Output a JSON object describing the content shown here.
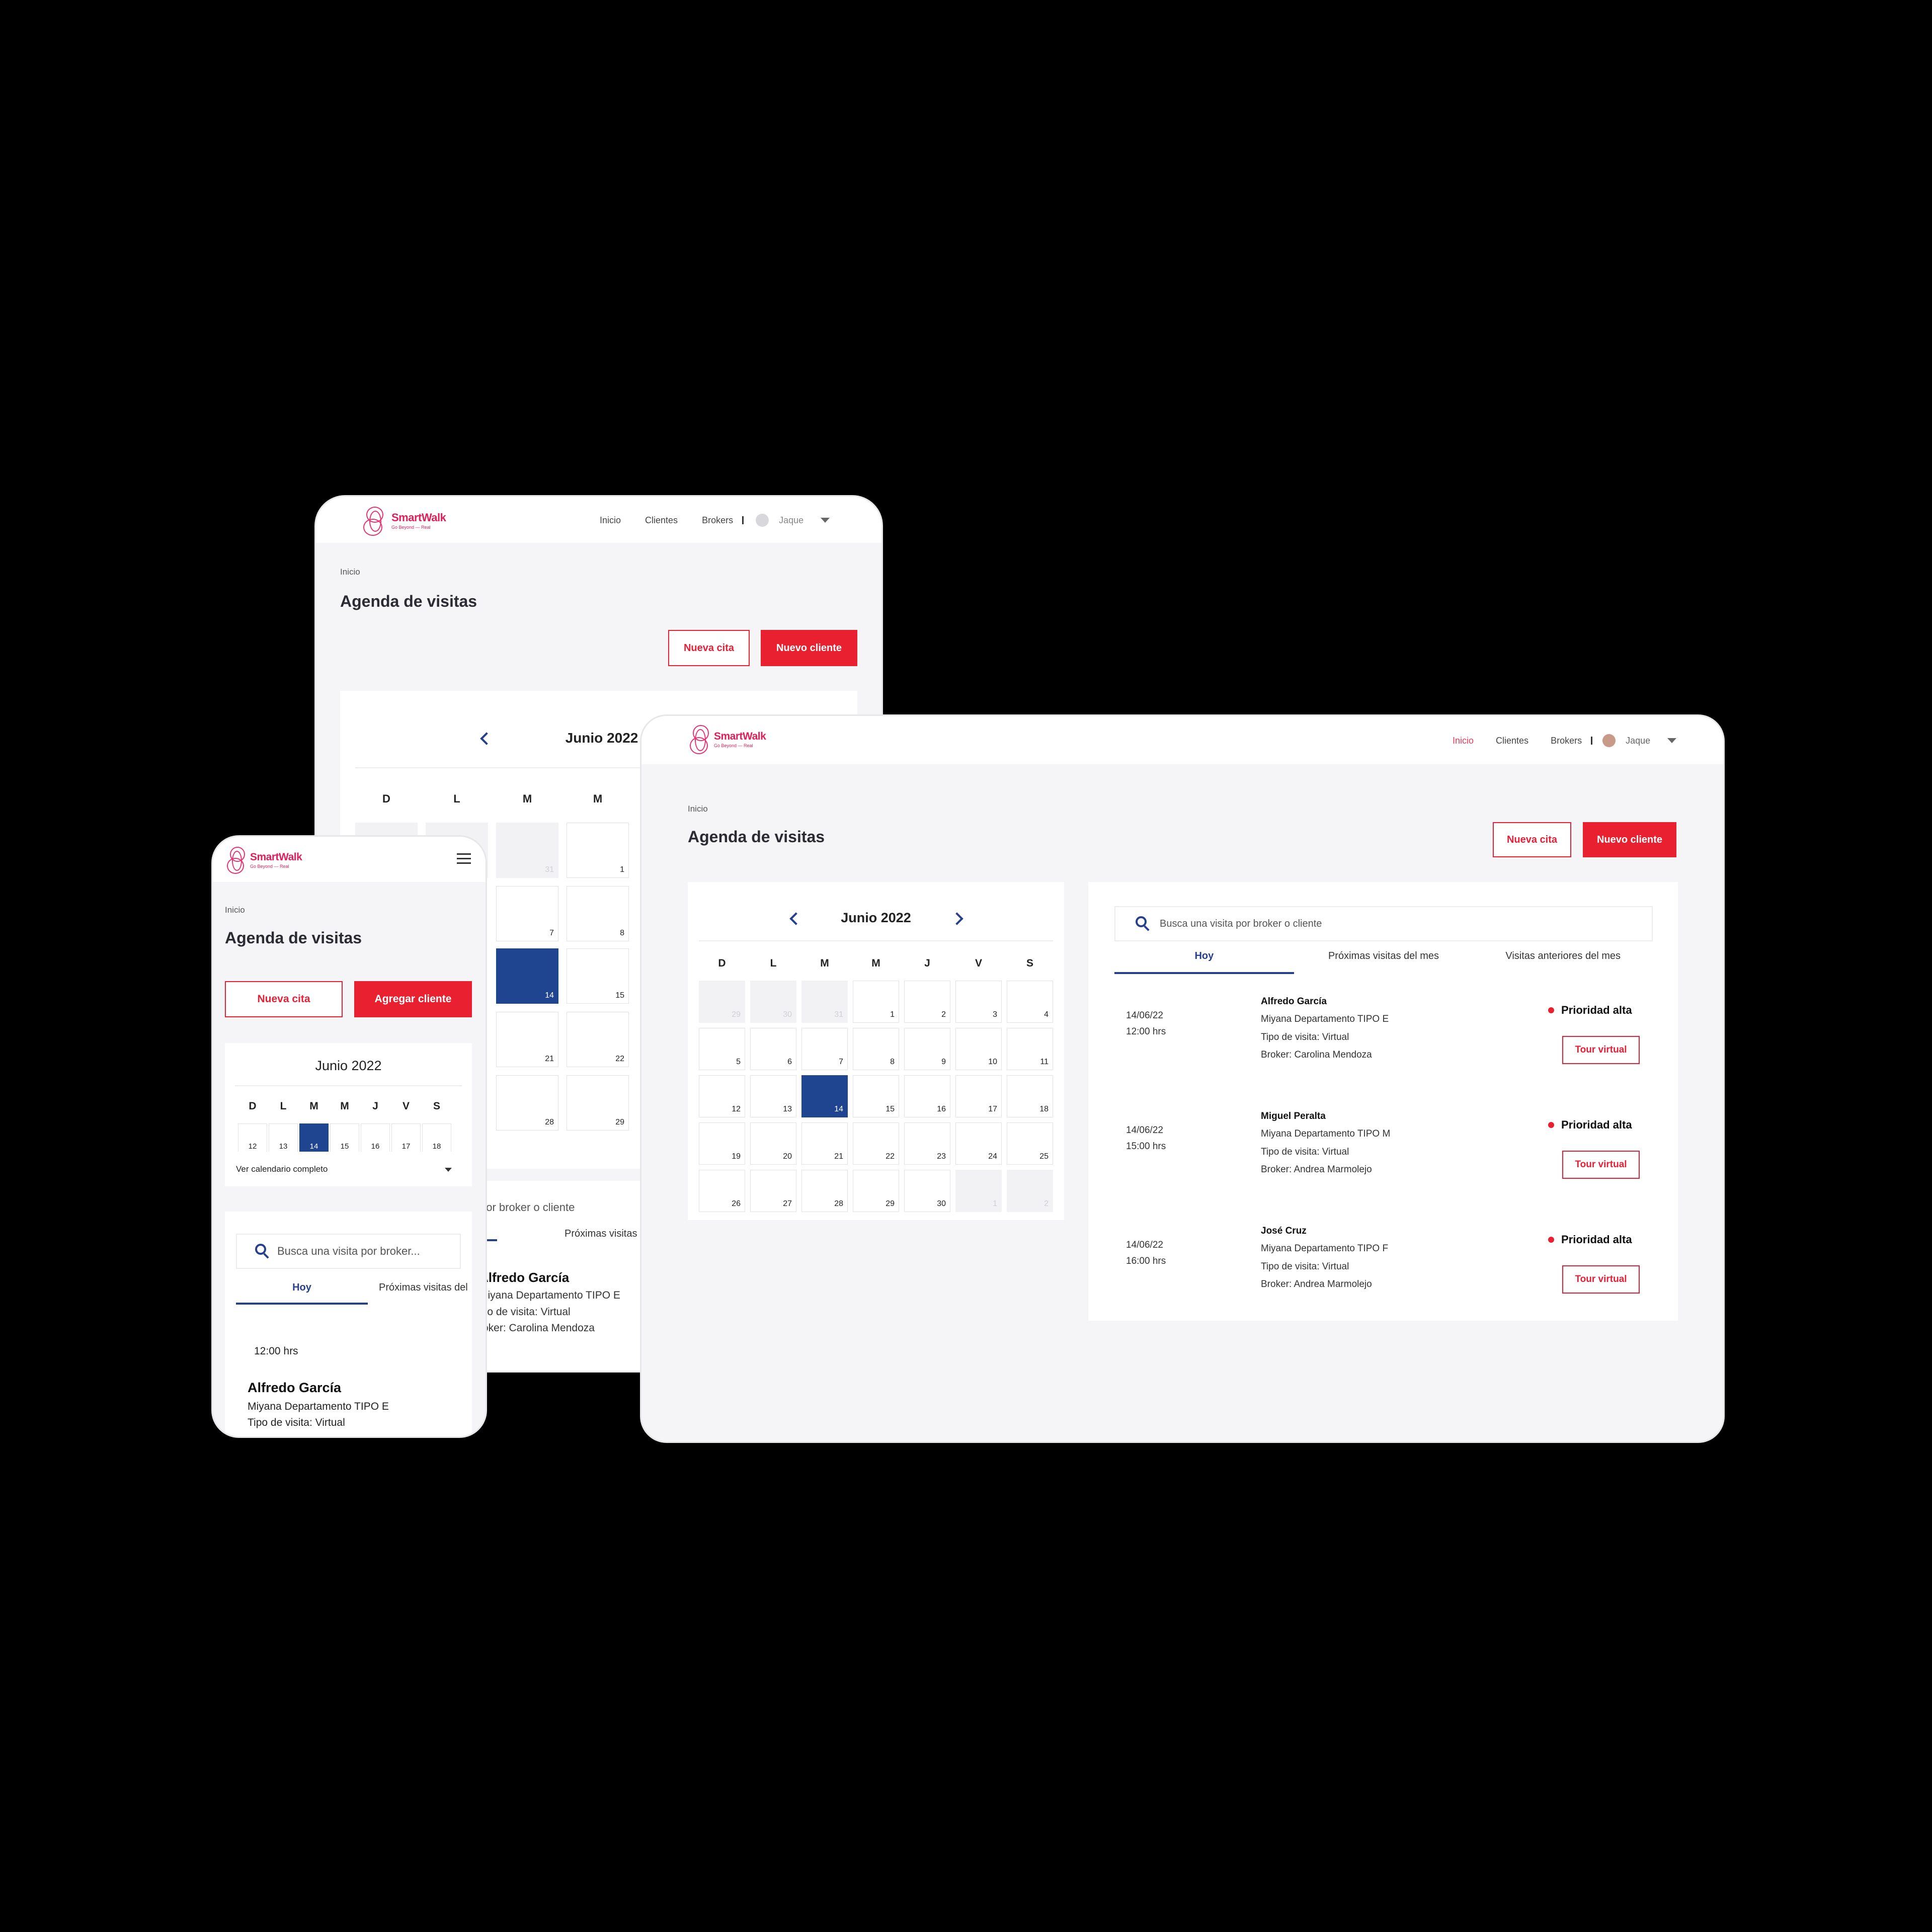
{
  "brand": {
    "name": "SmartWalk",
    "tagline": "Go Beyond — Real",
    "color": "#e0205a"
  },
  "colors": {
    "accent_red": "#e8202f",
    "selected_blue": "#1f4591",
    "nav_active": "#ec3a5b"
  },
  "nav": {
    "inicio": "Inicio",
    "clientes": "Clientes",
    "brokers": "Brokers",
    "user": "Jaque"
  },
  "page": {
    "breadcrumb": "Inicio",
    "title": "Agenda de visitas"
  },
  "buttons": {
    "nueva_cita": "Nueva cita",
    "nuevo_cliente": "Nuevo cliente",
    "agregar_cliente": "Agregar cliente",
    "tour": "Tour virtual"
  },
  "calendar": {
    "month": "Junio 2022",
    "weekdays": [
      "D",
      "L",
      "M",
      "M",
      "J",
      "V",
      "S"
    ],
    "weeks": [
      [
        "29",
        "30",
        "31",
        "1",
        "2",
        "3",
        "4"
      ],
      [
        "5",
        "6",
        "7",
        "8",
        "9",
        "10",
        "11"
      ],
      [
        "12",
        "13",
        "14",
        "15",
        "16",
        "17",
        "18"
      ],
      [
        "19",
        "20",
        "21",
        "22",
        "23",
        "24",
        "25"
      ],
      [
        "26",
        "27",
        "28",
        "29",
        "30",
        "1",
        "2"
      ]
    ],
    "selected_day": "14",
    "ver_completo": "Ver calendario completo"
  },
  "search": {
    "placeholder": "Busca una visita por broker o cliente",
    "placeholder_short": "Busca una visita por broker...",
    "tablet_partial": "por broker o cliente"
  },
  "tabs": {
    "hoy": "Hoy",
    "proximas": "Próximas visitas del mes",
    "anteriores": "Visitas anteriores del mes",
    "proximas_cut": "Próximas visitas del",
    "proximas_tablet": "Próximas visitas del m"
  },
  "visits": [
    {
      "date": "14/06/22",
      "time": "12:00 hrs",
      "name": "Alfredo García",
      "property": "Miyana Departamento TIPO E",
      "type": "Tipo de visita: Virtual",
      "broker": "Broker: Carolina Mendoza",
      "priority": "Prioridad alta"
    },
    {
      "date": "14/06/22",
      "time": "15:00 hrs",
      "name": "Miguel Peralta",
      "property": "Miyana Departamento TIPO M",
      "type": "Tipo de visita: Virtual",
      "broker": "Broker: Andrea Marmolejo",
      "priority": "Prioridad alta"
    },
    {
      "date": "14/06/22",
      "time": "16:00 hrs",
      "name": "José Cruz",
      "property": "Miyana Departamento TIPO F",
      "type": "Tipo de visita: Virtual",
      "broker": "Broker: Andrea Marmolejo",
      "priority": "Prioridad alta"
    }
  ],
  "tablet_cut": {
    "name": "Alfredo García",
    "property": "Miyana Departamento TIPO E",
    "type": "ipo de visita: Virtual",
    "broker": "roker: Carolina Mendoza"
  },
  "phone_visit": {
    "time": "12:00 hrs",
    "name": "Alfredo García",
    "property": "Miyana Departamento TIPO E",
    "type": "Tipo de visita: Virtual"
  },
  "phone_week": [
    "12",
    "13",
    "14",
    "15",
    "16",
    "17",
    "18"
  ]
}
